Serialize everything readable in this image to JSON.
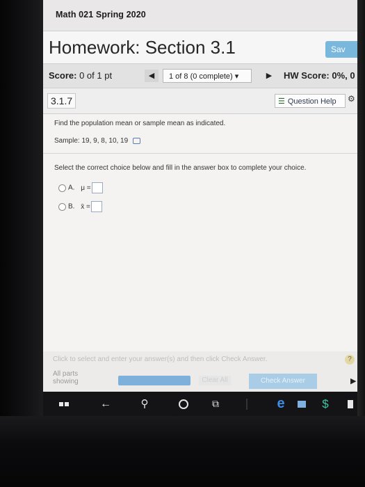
{
  "course": {
    "title": "Math 021 Spring 2020"
  },
  "header": {
    "title": "Homework: Section 3.1",
    "save_label": "Sav"
  },
  "score_bar": {
    "score_label": "Score:",
    "score_value": "0 of 1 pt",
    "prev_icon": "triangle-left-icon",
    "question_select": "1 of 8 (0 complete) ▾",
    "next_icon": "triangle-right-icon",
    "hw_score": "HW Score: 0%, 0"
  },
  "question_bar": {
    "number": "3.1.7",
    "help_label": "Question Help",
    "options_icon": "gear-icon"
  },
  "question": {
    "prompt": "Find the population mean or sample mean as indicated.",
    "sample": "Sample: 19, 9, 8, 10, 19",
    "instruction": "Select the correct choice below and fill in the answer box to complete your choice.",
    "choices": [
      {
        "letter": "A.",
        "symbol": "μ ="
      },
      {
        "letter": "B.",
        "symbol": "x̄ ="
      }
    ]
  },
  "footer": {
    "hint": "Click to select and enter your answer(s) and then click Check Answer.",
    "help_icon": "?",
    "parts_line1": "All parts",
    "parts_line2": "showing",
    "clear_all": "Clear All",
    "check_answer": "Check Answer"
  },
  "taskbar": {
    "icons": [
      "windows-icon",
      "back-arrow-icon",
      "search-icon",
      "cortana-icon",
      "task-view-icon",
      "edge-icon",
      "store-icon",
      "dollar-app-icon",
      "app-icon"
    ]
  }
}
